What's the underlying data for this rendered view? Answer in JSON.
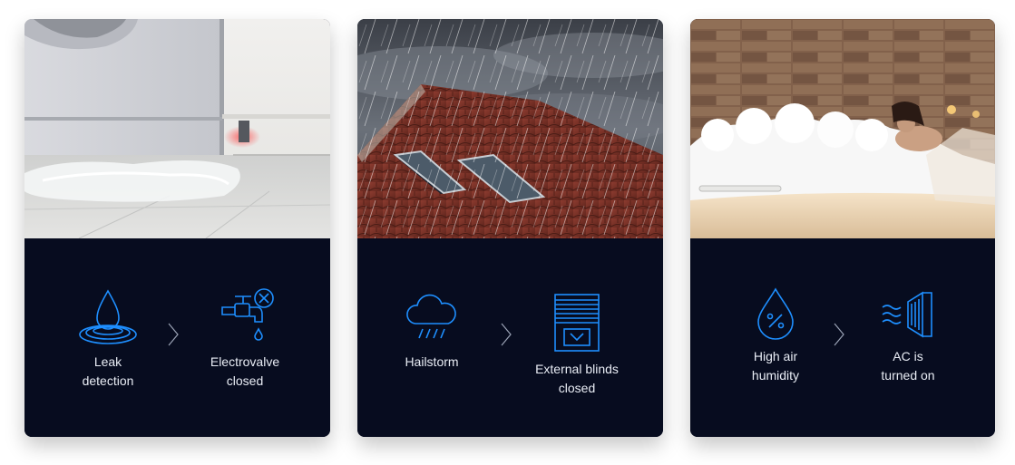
{
  "cards": [
    {
      "photo_subject": "washing machine leaking water on tiled floor",
      "trigger_icon": "water-drop-ripple-icon",
      "trigger_label": "Leak\ndetection",
      "arrow_icon": "chevron-right-icon",
      "action_icon": "faucet-closed-icon",
      "action_label": "Electrovalve\nclosed"
    },
    {
      "photo_subject": "rain storm over red tiled roof with skylights",
      "trigger_icon": "cloud-rain-icon",
      "trigger_label": "Hailstorm",
      "arrow_icon": "chevron-right-icon",
      "action_icon": "window-blinds-down-icon",
      "action_label": "External blinds\nclosed"
    },
    {
      "photo_subject": "woman relaxing in bubble bath",
      "trigger_icon": "humidity-drop-percent-icon",
      "trigger_label": "High air\nhumidity",
      "arrow_icon": "chevron-right-icon",
      "action_icon": "ac-airflow-icon",
      "action_label": "AC is\nturned on"
    }
  ],
  "colors": {
    "panel_bg": "#070c1f",
    "icon_blue": "#1e8fff",
    "label_text": "#e9edf5",
    "chevron": "#9aa3b5"
  }
}
